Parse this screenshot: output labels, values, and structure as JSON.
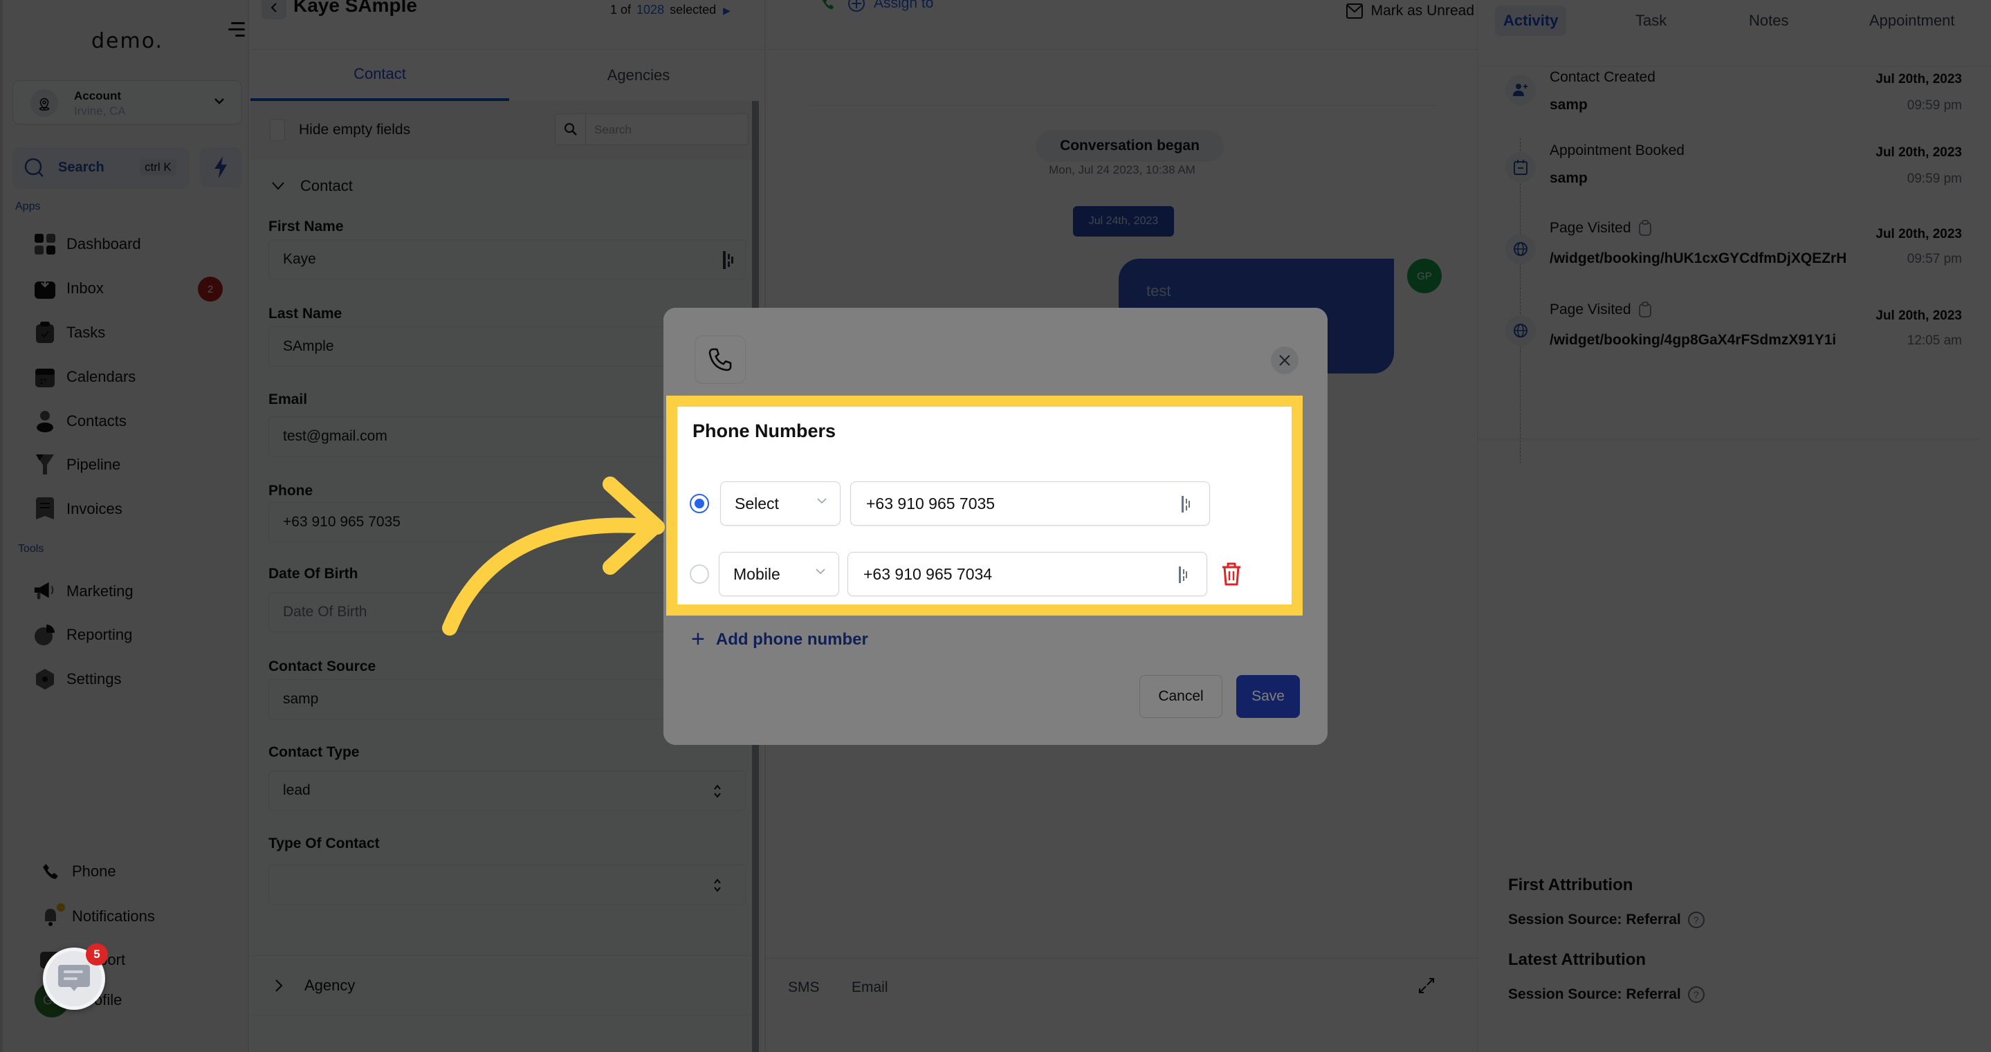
{
  "sidebar": {
    "logo": "demo.",
    "account": {
      "name": "Account",
      "location": "Irvine, CA"
    },
    "search": {
      "label": "Search",
      "shortcut": "ctrl K"
    },
    "apps_label": "Apps",
    "tools_label": "Tools",
    "apps": [
      {
        "label": "Dashboard",
        "icon": "dashboard-icon"
      },
      {
        "label": "Inbox",
        "icon": "inbox-icon",
        "badge": "2"
      },
      {
        "label": "Tasks",
        "icon": "clipboard-check-icon"
      },
      {
        "label": "Calendars",
        "icon": "calendar-icon"
      },
      {
        "label": "Contacts",
        "icon": "user-icon"
      },
      {
        "label": "Pipeline",
        "icon": "funnel-icon"
      },
      {
        "label": "Invoices",
        "icon": "receipt-icon"
      }
    ],
    "tools": [
      {
        "label": "Marketing",
        "icon": "megaphone-icon"
      },
      {
        "label": "Reporting",
        "icon": "pie-chart-icon"
      },
      {
        "label": "Settings",
        "icon": "gear-icon"
      }
    ],
    "bottom": [
      {
        "label": "Phone",
        "icon": "phone-icon"
      },
      {
        "label": "Notifications",
        "icon": "bell-icon"
      },
      {
        "label": "Support",
        "icon": "support-icon"
      },
      {
        "label": "Profile",
        "icon": "avatar",
        "initials": "GP"
      }
    ],
    "chat_fab_badge": "5"
  },
  "contact_panel": {
    "title": "Kaye SAmple",
    "pager": {
      "prefix": "1 of",
      "count": "1028",
      "suffix": "selected"
    },
    "tabs": [
      {
        "label": "Contact",
        "active": true
      },
      {
        "label": "Agencies",
        "active": false
      }
    ],
    "hide_empty_label": "Hide empty fields",
    "search_placeholder": "Search",
    "section": "Contact",
    "fields": [
      {
        "label": "First Name",
        "value": "Kaye"
      },
      {
        "label": "Last Name",
        "value": "SAmple"
      },
      {
        "label": "Email",
        "value": "test@gmail.com"
      },
      {
        "label": "Phone",
        "value": "+63 910 965 7035"
      },
      {
        "label": "Date Of Birth",
        "value": "",
        "placeholder": "Date Of Birth"
      },
      {
        "label": "Contact Source",
        "value": "samp"
      },
      {
        "label": "Contact Type",
        "value": "lead"
      },
      {
        "label": "Type Of Contact",
        "value": ""
      }
    ],
    "collapsed_section": "Agency"
  },
  "conversation": {
    "assign_label": "Assign to",
    "mark_unread_label": "Mark as Unread",
    "began_label": "Conversation began",
    "began_timestamp": "Mon, Jul 24 2023, 10:38 AM",
    "date_chip": "Jul 24th, 2023",
    "message": "test",
    "message_avatar": "GP",
    "channels": [
      "SMS",
      "Email"
    ]
  },
  "right_panel": {
    "tabs": [
      {
        "label": "Activity",
        "active": true
      },
      {
        "label": "Task",
        "active": false
      },
      {
        "label": "Notes",
        "active": false
      },
      {
        "label": "Appointment",
        "active": false
      }
    ],
    "activities": [
      {
        "title": "Contact Created",
        "detail": "samp",
        "date": "Jul 20th, 2023",
        "time": "09:59 pm",
        "icon": "user-plus-icon",
        "copy": false
      },
      {
        "title": "Appointment Booked",
        "detail": "samp",
        "date": "Jul 20th, 2023",
        "time": "09:59 pm",
        "icon": "calendar-icon",
        "copy": false
      },
      {
        "title": "Page Visited",
        "detail": "/widget/booking/hUK1cxGYCdfmDjXQEZrH",
        "date": "Jul 20th, 2023",
        "time": "09:57 pm",
        "icon": "globe-icon",
        "copy": true
      },
      {
        "title": "Page Visited",
        "detail": "/widget/booking/4gp8GaX4rFSdmzX91Y1i",
        "date": "Jul 20th, 2023",
        "time": "12:05 am",
        "icon": "globe-icon",
        "copy": true
      }
    ],
    "first_attribution": {
      "title": "First Attribution",
      "line": "Session Source: Referral"
    },
    "latest_attribution": {
      "title": "Latest Attribution",
      "line": "Session Source: Referral"
    }
  },
  "modal": {
    "title": "Phone Numbers",
    "rows": [
      {
        "type": "Select",
        "number": "+63 910 965 7035",
        "primary": true,
        "deletable": false
      },
      {
        "type": "Mobile",
        "number": "+63 910 965 7034",
        "primary": false,
        "deletable": true
      }
    ],
    "add_label": "Add phone number",
    "cancel_label": "Cancel",
    "save_label": "Save"
  },
  "colors": {
    "highlight": "#fdd043",
    "primary": "#2545c8",
    "danger": "#dc2626"
  }
}
